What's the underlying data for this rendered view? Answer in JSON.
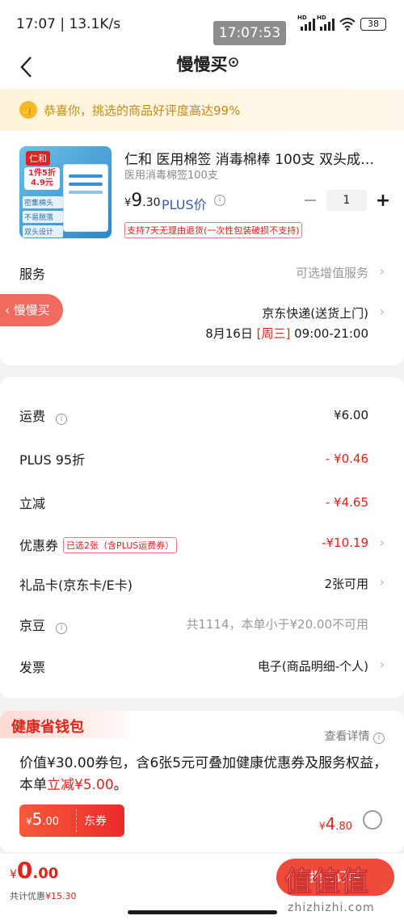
{
  "status_bar": {
    "left_text": "17:07 | 13.1K/s",
    "time_bubble": "17:07:53",
    "battery": "38",
    "hd": "HD"
  },
  "nav": {
    "title": "慢慢买"
  },
  "banner": {
    "text": "恭喜你，挑选的商品好评度高达99%"
  },
  "product": {
    "name": "仁和 医用棉签 消毒棉棒 100支 双头成人…",
    "spec": "医用消毒棉签100支",
    "price_symbol": "¥",
    "price_int": "9",
    "price_dec": ".30",
    "plus_label": "PLUS价",
    "quantity": "1",
    "minus": "−",
    "plus": "+",
    "return_policy": "支持7天无理由退货(一次性包装破损不支持)",
    "image": {
      "brand": "仁和",
      "promo_line1": "1件5折",
      "promo_line2": "4.9元",
      "tag1": "密集棉头",
      "tag2": "不易脱落",
      "tag3": "双头设计"
    }
  },
  "service": {
    "label": "服务",
    "value": "可选增值服务"
  },
  "delivery": {
    "label": "配送",
    "value": "京东快递(送货上门)",
    "date": "8月16日",
    "weekday": "[周三]",
    "time": "09:00-21:00"
  },
  "floating_tab": {
    "label": "慢慢买"
  },
  "fees": {
    "shipping": {
      "label": "运费",
      "value": "¥6.00"
    },
    "plus_discount": {
      "label": "PLUS 95折",
      "value": "- ¥0.46"
    },
    "instant_cut": {
      "label": "立减",
      "value": "- ¥4.65"
    },
    "coupon": {
      "label": "优惠券",
      "tag": "已选2张（含PLUS运费券）",
      "value": "-¥10.19"
    },
    "gift_card": {
      "label": "礼品卡(京东卡/E卡)",
      "value": "2张可用"
    },
    "jingdou": {
      "label": "京豆",
      "value": "共1114，本单小于¥20.00不可用"
    },
    "invoice": {
      "label": "发票",
      "value": "电子(商品明细-个人)"
    }
  },
  "wallet": {
    "title": "健康省钱包",
    "detail": "查看详情",
    "desc_prefix": "价值¥30.00券包，含6张5元可叠加健康优惠券及服务权益，本单",
    "desc_highlight": "立减¥5.00",
    "desc_suffix": "。",
    "voucher_symbol": "¥",
    "voucher_int": "5",
    "voucher_dec": ".00",
    "voucher_label": "东券",
    "price_symbol": "¥",
    "price_int": "4",
    "price_dec": ".80"
  },
  "bottom": {
    "total_symbol": "¥",
    "total_int": "0",
    "total_dec": ".00",
    "saved_label": "共计优惠",
    "saved_value": "¥15.30",
    "submit": "提交订单",
    "watermark_logo": "值值值",
    "watermark_url": "zhizhizhi.com"
  },
  "colors": {
    "accent_red": "#e2231a",
    "plus_blue": "#3a5bb5",
    "banner_gold": "#c88a14"
  }
}
